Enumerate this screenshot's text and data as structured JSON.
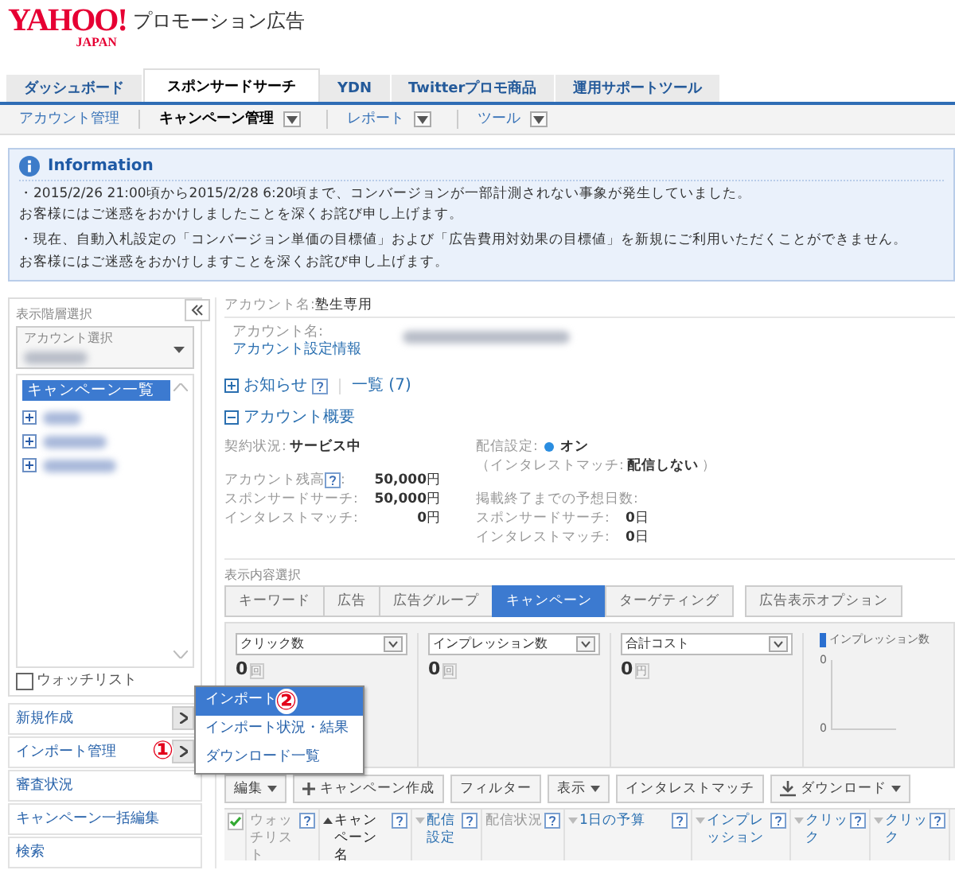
{
  "logo": {
    "brand": "YAHOO!",
    "sub": "JAPAN",
    "product": "プロモーション広告"
  },
  "tabs": [
    {
      "label": "ダッシュボード",
      "selected": false
    },
    {
      "label": "スポンサードサーチ",
      "selected": true
    },
    {
      "label": "YDN",
      "selected": false
    },
    {
      "label": "Twitterプロモ商品",
      "selected": false
    },
    {
      "label": "運用サポートツール",
      "selected": false
    }
  ],
  "subnav": [
    {
      "label": "アカウント管理",
      "selected": false,
      "dropdown": false
    },
    {
      "label": "キャンペーン管理",
      "selected": true,
      "dropdown": true
    },
    {
      "label": "レポート",
      "selected": false,
      "dropdown": true
    },
    {
      "label": "ツール",
      "selected": false,
      "dropdown": true
    }
  ],
  "information": {
    "title": "Information",
    "lines": [
      "・2015/2/26 21:00頃から2015/2/28 6:20頃まで、コンバージョンが一部計測されない事象が発生していました。",
      "お客様にはご迷惑をおかけしましたことを深くお詫び申し上げます。",
      "・現在、自動入札設定の「コンバージョン単価の目標値」および「広告費用対効果の目標値」を新規にご利用いただくことができません。",
      "お客様にはご迷惑をおかけしますことを深くお詫び申し上げます。"
    ]
  },
  "sidebar": {
    "level_label": "表示階層選択",
    "account_select_label": "アカウント選択",
    "tree_header": "キャンペーン一覧",
    "campaigns": [
      {
        "expanded": false
      },
      {
        "expanded": false
      },
      {
        "expanded": false
      }
    ],
    "watchlist": {
      "label": "ウォッチリスト",
      "checked": false
    },
    "menu": [
      {
        "label": "新規作成",
        "submenu": true
      },
      {
        "label": "インポート管理",
        "submenu": true,
        "annotation": "①"
      },
      {
        "label": "審査状況",
        "submenu": false
      },
      {
        "label": "キャンペーン一括編集",
        "submenu": false
      },
      {
        "label": "検索",
        "submenu": false
      }
    ]
  },
  "popup_menu": [
    {
      "label": "インポート",
      "selected": true,
      "annotation": "②"
    },
    {
      "label": "インポート状況・結果",
      "selected": false
    },
    {
      "label": "ダウンロード一覧",
      "selected": false
    }
  ],
  "account": {
    "label": "アカウント名:",
    "name": "塾生専用",
    "box_label": "アカウント名:",
    "settings_link": "アカウント設定情報"
  },
  "notice": {
    "label": "お知らせ",
    "expanded": false,
    "list_link": "一覧 (7)"
  },
  "overview": {
    "label": "アカウント概要",
    "expanded": true,
    "contract_label": "契約状況:",
    "contract": "サービス中",
    "balance_label": "アカウント残高",
    "balance_colon": ":",
    "balance": "50,000",
    "balance_unit": "円",
    "balances": [
      {
        "label": "スポンサードサーチ:",
        "value": "50,000",
        "unit": "円"
      },
      {
        "label": "インタレストマッチ:",
        "value": "0",
        "unit": "円"
      }
    ],
    "delivery_label": "配信設定:",
    "delivery_on": true,
    "delivery": "オン",
    "im_label": "（インタレストマッチ:",
    "im_value": "配信しない",
    "im_close": "）",
    "days_label": "掲載終了までの予想日数:",
    "days": [
      {
        "label": "スポンサードサーチ:",
        "value": "0",
        "unit": "日"
      },
      {
        "label": "インタレストマッチ:",
        "value": "0",
        "unit": "日"
      }
    ]
  },
  "view_select": {
    "label": "表示内容選択",
    "tabs": [
      {
        "label": "キーワード",
        "selected": false
      },
      {
        "label": "広告",
        "selected": false
      },
      {
        "label": "広告グループ",
        "selected": false
      },
      {
        "label": "キャンペーン",
        "selected": true
      },
      {
        "label": "ターゲティング",
        "selected": false
      }
    ],
    "extra_tab": "広告表示オプション"
  },
  "metrics": [
    {
      "select": "クリック数",
      "value": "0",
      "unit": "回"
    },
    {
      "select": "インプレッション数",
      "value": "0",
      "unit": "回"
    },
    {
      "select": "合計コスト",
      "value": "0",
      "unit": "円"
    }
  ],
  "mini_chart": {
    "legend": "インプレッション数",
    "ticks": [
      "0",
      "0"
    ]
  },
  "toolbar": [
    {
      "label": "編集",
      "kind": "dropdown"
    },
    {
      "label": "キャンペーン作成",
      "kind": "add"
    },
    {
      "label": "フィルター",
      "kind": "plain"
    },
    {
      "label": "表示",
      "kind": "dropdown"
    },
    {
      "label": "インタレストマッチ",
      "kind": "plain"
    },
    {
      "label": "ダウンロード",
      "kind": "download"
    }
  ],
  "table": {
    "all_checked": true,
    "columns": [
      {
        "label": "ウォッチリスト",
        "sort_arrow": false,
        "ascending": false,
        "link": false
      },
      {
        "label": "キャンペーン名",
        "sort_arrow": true,
        "ascending": true,
        "link": false
      },
      {
        "label": "配信設定",
        "sort_arrow": true,
        "ascending": false,
        "link": true
      },
      {
        "label": "配信状況",
        "sort_arrow": false,
        "ascending": false,
        "link": false
      },
      {
        "label": "1日の予算",
        "sort_arrow": true,
        "ascending": false,
        "link": true
      },
      {
        "label": "インプレッション",
        "sort_arrow": true,
        "ascending": false,
        "link": true
      },
      {
        "label": "クリック",
        "sort_arrow": true,
        "ascending": false,
        "link": true
      },
      {
        "label": "クリック",
        "sort_arrow": true,
        "ascending": false,
        "link": true
      }
    ]
  }
}
